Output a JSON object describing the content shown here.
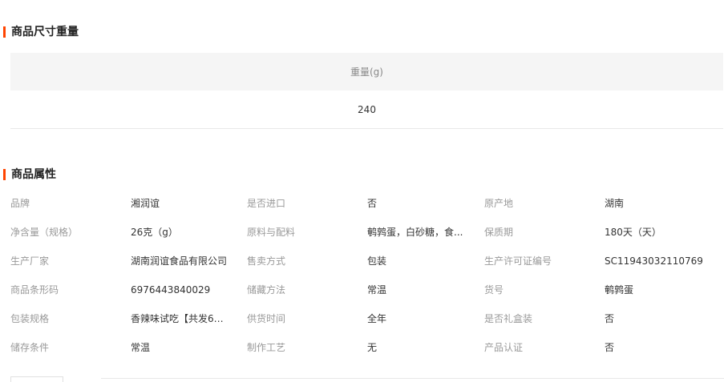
{
  "colors": {
    "accent": "#ff4400",
    "header_bg": "#f5f5f5",
    "label_text": "#999999",
    "value_text": "#333333"
  },
  "size_section": {
    "title": "商品尺寸重量",
    "header": "重量(g)",
    "value": "240"
  },
  "attr_section": {
    "title": "商品属性",
    "rows": [
      [
        {
          "label": "品牌",
          "value": "湘润谊"
        },
        {
          "label": "是否进口",
          "value": "否"
        },
        {
          "label": "原产地",
          "value": "湖南"
        }
      ],
      [
        {
          "label": "净含量（规格）",
          "value": "26克（g）"
        },
        {
          "label": "原料与配料",
          "value": "鹌鹑蛋，白砂糖，食..."
        },
        {
          "label": "保质期",
          "value": "180天（天）"
        }
      ],
      [
        {
          "label": "生产厂家",
          "value": "湖南润谊食品有限公司"
        },
        {
          "label": "售卖方式",
          "value": "包装"
        },
        {
          "label": "生产许可证编号",
          "value": "SC11943032110769"
        }
      ],
      [
        {
          "label": "商品条形码",
          "value": "6976443840029"
        },
        {
          "label": "储藏方法",
          "value": "常温"
        },
        {
          "label": "货号",
          "value": "鹌鹑蛋"
        }
      ],
      [
        {
          "label": "包装规格",
          "value": "香辣味试吃【共发6枚..."
        },
        {
          "label": "供货时间",
          "value": "全年"
        },
        {
          "label": "是否礼盒装",
          "value": "否"
        }
      ],
      [
        {
          "label": "储存条件",
          "value": "常温"
        },
        {
          "label": "制作工艺",
          "value": "无"
        },
        {
          "label": "产品认证",
          "value": "否"
        }
      ]
    ]
  }
}
